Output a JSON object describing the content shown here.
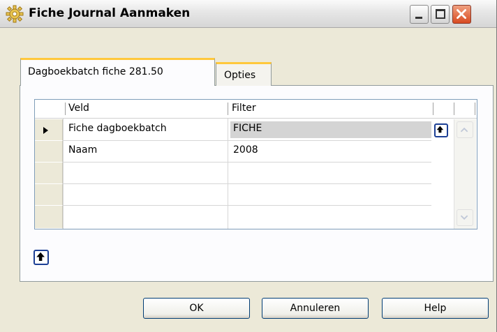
{
  "window": {
    "title": "Fiche Journal Aanmaken",
    "icon": "gear-icon"
  },
  "titlebar_buttons": {
    "minimize": "minimize-icon",
    "maximize": "maximize-icon",
    "close": "close-icon"
  },
  "tabs": [
    {
      "label": "Dagboekbatch fiche 281.50",
      "active": true
    },
    {
      "label": "Opties",
      "active": false
    }
  ],
  "grid": {
    "columns": [
      "Veld",
      "Filter"
    ],
    "rows": [
      {
        "veld": "Fiche dagboekbatch",
        "filter": "FICHE",
        "current": true
      },
      {
        "veld": "Naam",
        "filter": "2008",
        "current": false
      },
      {
        "veld": "",
        "filter": "",
        "current": false
      },
      {
        "veld": "",
        "filter": "",
        "current": false
      },
      {
        "veld": "",
        "filter": "",
        "current": false
      }
    ]
  },
  "buttons": {
    "ok": "OK",
    "cancel": "Annuleren",
    "help": "Help"
  },
  "colors": {
    "accent_tab": "#ffc83c",
    "close_button": "#d84a20",
    "button_border": "#003c74"
  }
}
